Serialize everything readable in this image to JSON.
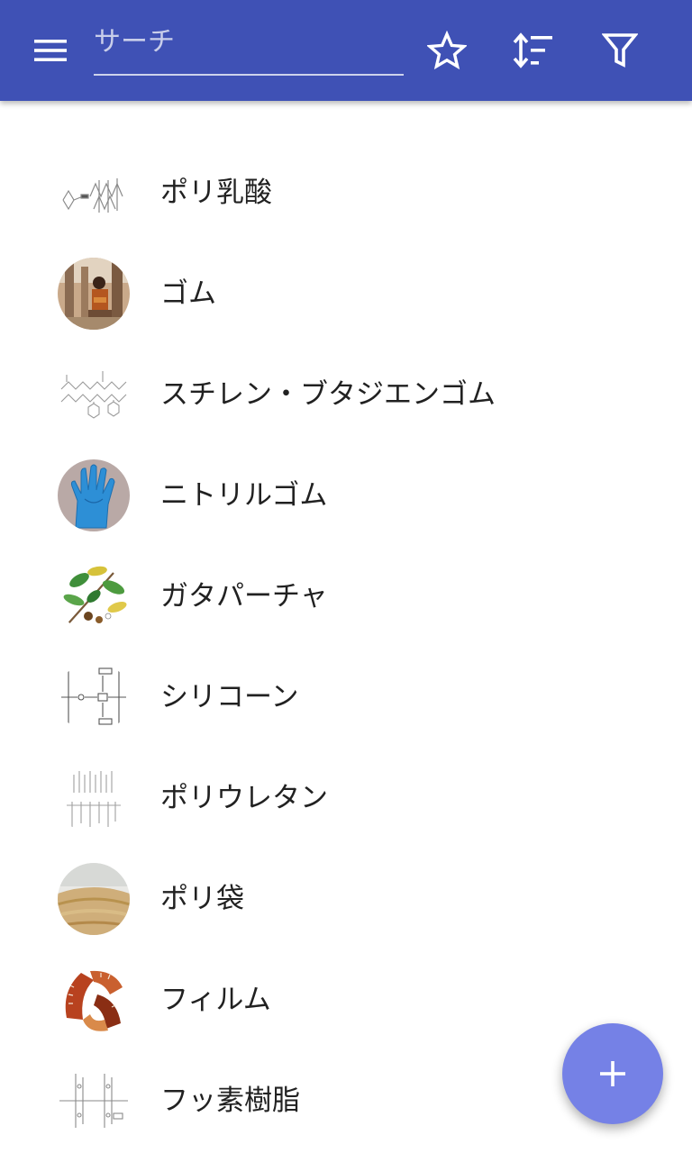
{
  "toolbar": {
    "background": "#3f51b5",
    "menu_icon": "hamburger-menu-icon",
    "search": {
      "value": "",
      "placeholder": "サーチ"
    },
    "actions": [
      {
        "icon": "star-outline-icon"
      },
      {
        "icon": "sort-icon"
      },
      {
        "icon": "filter-icon"
      }
    ]
  },
  "list": {
    "items": [
      {
        "label": "ポリ乳酸",
        "thumbnail": "structural-formula"
      },
      {
        "label": "ゴム",
        "thumbnail": "rubber-tapping-photo"
      },
      {
        "label": "スチレン・ブタジエンゴム",
        "thumbnail": "structural-formula"
      },
      {
        "label": "ニトリルゴム",
        "thumbnail": "blue-glove-photo"
      },
      {
        "label": "ガタパーチャ",
        "thumbnail": "plant-illustration"
      },
      {
        "label": "シリコーン",
        "thumbnail": "structural-formula"
      },
      {
        "label": "ポリウレタン",
        "thumbnail": "structural-formula"
      },
      {
        "label": "ポリ袋",
        "thumbnail": "bag-photo"
      },
      {
        "label": "フィルム",
        "thumbnail": "film-reel-photo"
      },
      {
        "label": "フッ素樹脂",
        "thumbnail": "structural-formula"
      }
    ]
  },
  "fab": {
    "icon": "plus-icon",
    "color": "#7581e6"
  }
}
